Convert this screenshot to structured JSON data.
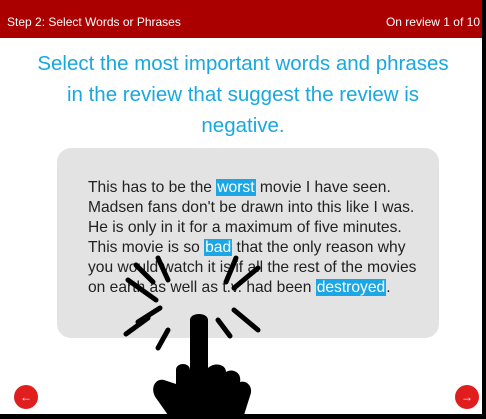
{
  "topbar": {
    "step_label": "Step 2: Select Words or Phrases",
    "progress_label": "On review 1 of 10"
  },
  "instruction": {
    "text": "Select the most important words and phrases in the review that suggest the review is negative."
  },
  "review": {
    "segments": [
      {
        "text": "This has to be the ",
        "highlighted": false
      },
      {
        "text": "worst",
        "highlighted": true
      },
      {
        "text": " movie I have seen. Madsen fans don't be drawn into this like I was. He is only in it for a maximum of five minutes. This movie is so ",
        "highlighted": false
      },
      {
        "text": "bad",
        "highlighted": true
      },
      {
        "text": " that the only reason why you would watch it is if all the rest of the movies on earth as well as t.v. had been ",
        "highlighted": false
      },
      {
        "text": "destroyed",
        "highlighted": true
      },
      {
        "text": ".",
        "highlighted": false
      }
    ]
  },
  "nav": {
    "prev_icon": "arrow-left-icon",
    "next_icon": "arrow-right-icon",
    "prev_glyph": "←",
    "next_glyph": "→"
  },
  "overlay": {
    "icon": "tap-hand-icon"
  },
  "colors": {
    "topbar": "#ab0000",
    "instruction": "#18a8e0",
    "highlight": "#1ba7e5",
    "card": "#e3e3e3",
    "nav_button": "#e01e1e"
  }
}
